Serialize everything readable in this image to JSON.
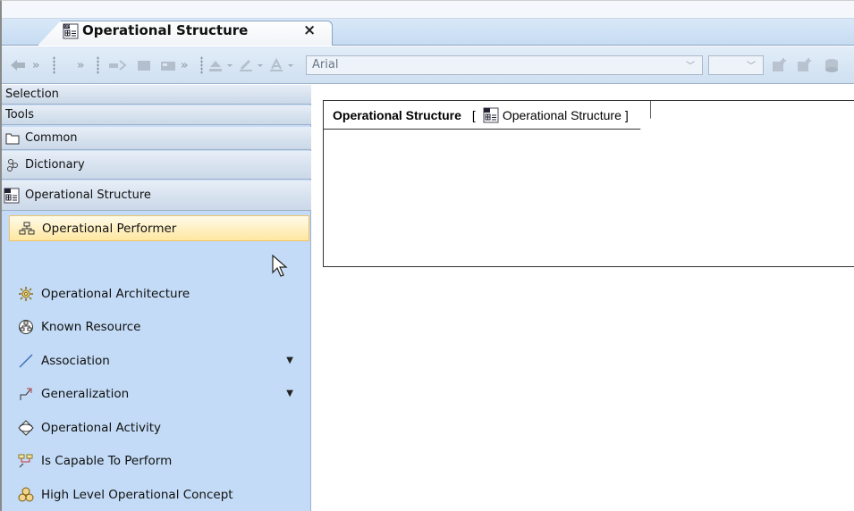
{
  "app": {
    "top_strip_text": "",
    "tab": {
      "title": "Operational Structure",
      "close_glyph": "×"
    }
  },
  "toolbar": {
    "font_combo": {
      "value": "Arial"
    },
    "size_combo": {
      "value": ""
    },
    "overflow_glyph": "»"
  },
  "palette": {
    "sections": [
      {
        "label": "Selection"
      },
      {
        "label": "Tools"
      },
      {
        "label": "Common"
      },
      {
        "label": "Dictionary"
      },
      {
        "label": "Operational Structure"
      }
    ],
    "items": [
      {
        "label": "Operational Performer",
        "icon": "performer-icon",
        "selected": true
      },
      {
        "label": "Operational Architecture",
        "icon": "architecture-icon"
      },
      {
        "label": "Known Resource",
        "icon": "resource-icon"
      },
      {
        "label": "Association",
        "icon": "association-icon",
        "has_dropdown": true
      },
      {
        "label": "Generalization",
        "icon": "generalization-icon",
        "has_dropdown": true
      },
      {
        "label": "Operational Activity",
        "icon": "activity-icon"
      },
      {
        "label": "Is Capable To Perform",
        "icon": "capable-icon"
      },
      {
        "label": "High Level Operational Concept",
        "icon": "concept-icon"
      }
    ]
  },
  "diagram": {
    "frame_title": "Operational Structure",
    "frame_type_label": "Operational Structure",
    "bracket_open": "[",
    "bracket_close": "]"
  },
  "colors": {
    "palette_bg": "#c3dbf6",
    "selected_bg": "#ffe7a0",
    "toolbar_bg": "#cfe0f1"
  }
}
